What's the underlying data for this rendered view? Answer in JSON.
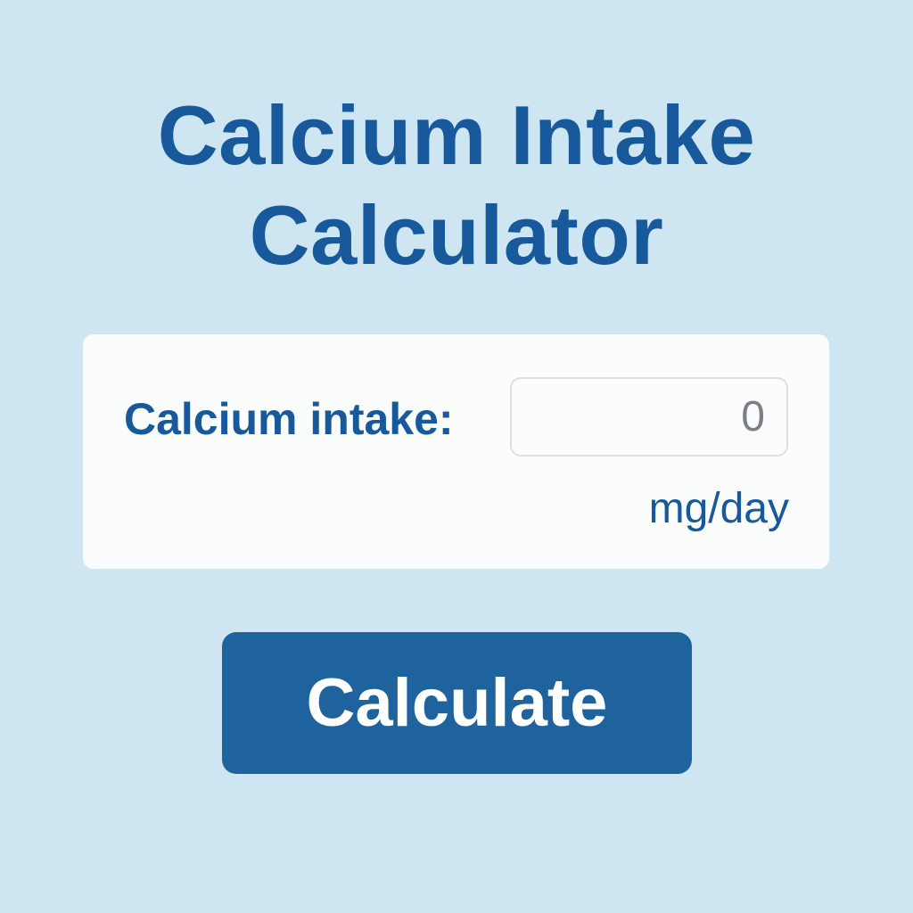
{
  "app": {
    "title_line_1": "Calcium Intake",
    "title_line_2": "Calculator"
  },
  "form": {
    "intake_label": "Calcium intake:",
    "intake_value": "0",
    "unit": "mg/day"
  },
  "actions": {
    "calculate_label": "Calculate"
  },
  "colors": {
    "background": "#cde6f1",
    "card": "#fbfcfc",
    "primary_text": "#17599a",
    "button": "#1f639e",
    "input_text": "#7b8088"
  }
}
